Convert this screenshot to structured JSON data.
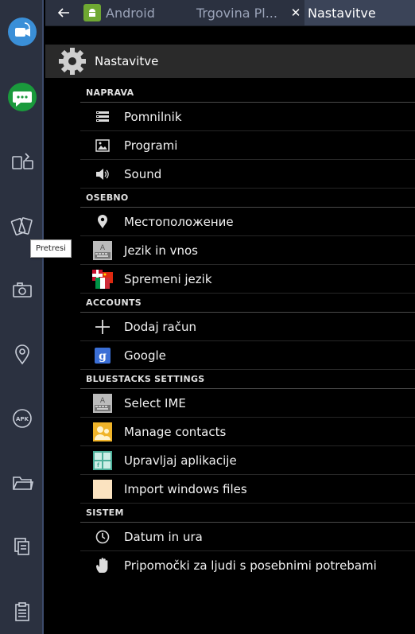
{
  "tabs": {
    "android": "Android",
    "store": "Trgovina Pl...",
    "store_close": "✕",
    "settings": "Nastavitve"
  },
  "tooltip": "Pretresi",
  "actionbar": {
    "title": "Nastavitve"
  },
  "sections": {
    "naprava": "NAPRAVA",
    "osebno": "OSEBNO",
    "accounts": "ACCOUNTS",
    "bluestacks": "BLUESTACKS SETTINGS",
    "sistem": "SISTEM"
  },
  "items": {
    "pomnilnik": "Pomnilnik",
    "programi": "Programi",
    "sound": "Sound",
    "location": "Местоположение",
    "jezik_vnos": "Jezik in vnos",
    "spremeni_jezik": "Spremeni jezik",
    "dodaj_racun": "Dodaj račun",
    "google": "Google",
    "select_ime": "Select IME",
    "manage_contacts": "Manage contacts",
    "upravljaj": "Upravljaj aplikacije",
    "import_files": "Import windows files",
    "datum": "Datum in ura",
    "pripomocki": "Pripomočki za ljudi s posebnimi potrebami"
  },
  "colors": {
    "sidebar_bg": "#2b3140",
    "active_tab": "#3b4458",
    "android_green": "#6fa832",
    "chat_green": "#1a9a3c",
    "video_blue": "#3a8fd8"
  }
}
